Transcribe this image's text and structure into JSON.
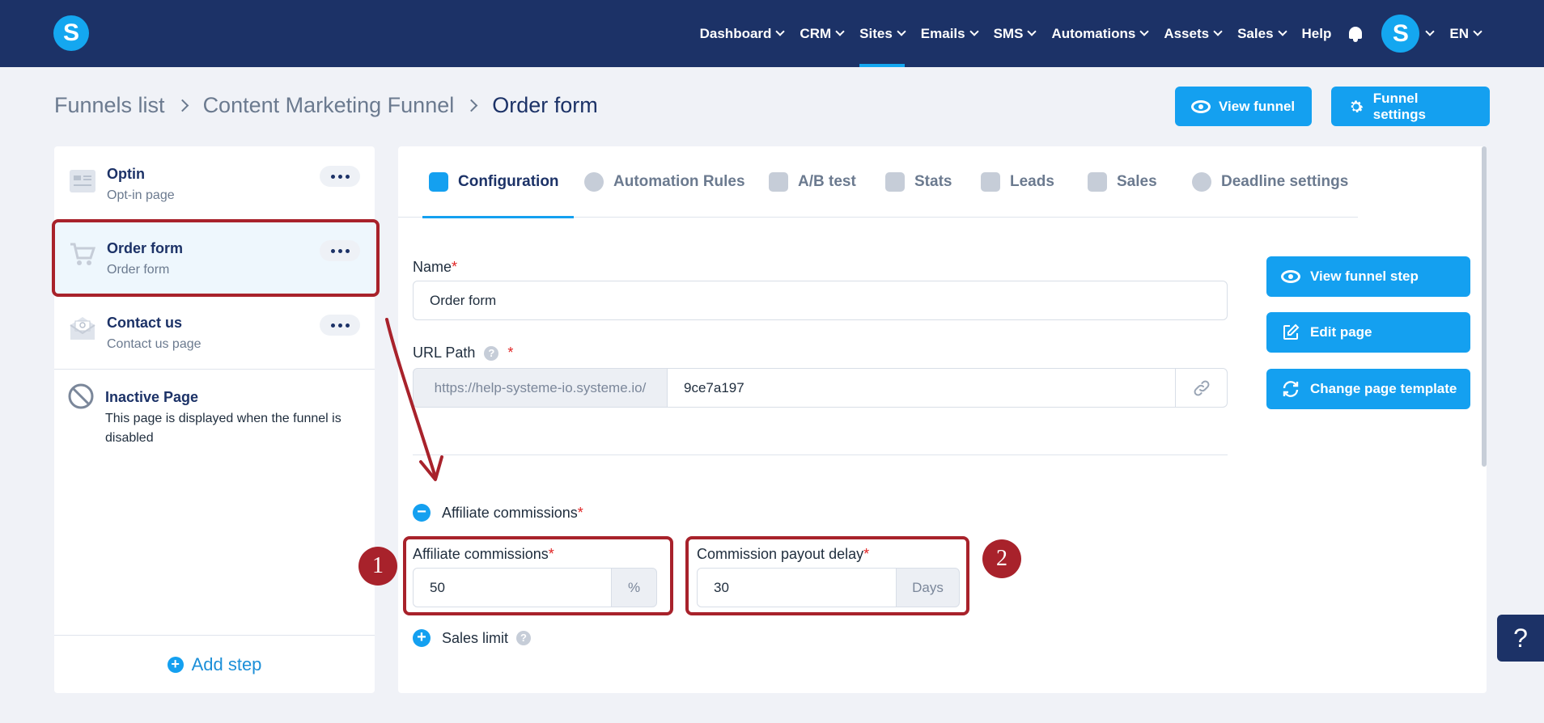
{
  "app": {
    "logo_letter": "S"
  },
  "nav": {
    "items": [
      {
        "label": "Dashboard",
        "chevron": true,
        "active": false
      },
      {
        "label": "CRM",
        "chevron": true,
        "active": false
      },
      {
        "label": "Sites",
        "chevron": true,
        "active": true
      },
      {
        "label": "Emails",
        "chevron": true,
        "active": false
      },
      {
        "label": "SMS",
        "chevron": true,
        "active": false
      },
      {
        "label": "Automations",
        "chevron": true,
        "active": false
      },
      {
        "label": "Assets",
        "chevron": true,
        "active": false
      },
      {
        "label": "Sales",
        "chevron": true,
        "active": false
      },
      {
        "label": "Help",
        "chevron": false,
        "active": false
      }
    ],
    "avatar_letter": "S",
    "language": "EN"
  },
  "breadcrumb": {
    "root": "Funnels list",
    "funnel": "Content Marketing Funnel",
    "current": "Order form"
  },
  "header_buttons": {
    "view_funnel": "View funnel",
    "funnel_settings": "Funnel settings"
  },
  "sidebar": {
    "steps": [
      {
        "title": "Optin",
        "subtitle": "Opt-in page"
      },
      {
        "title": "Order form",
        "subtitle": "Order form"
      },
      {
        "title": "Contact us",
        "subtitle": "Contact us page"
      }
    ],
    "inactive": {
      "title": "Inactive Page",
      "desc_line1": "This page is displayed when the funnel is",
      "desc_line2": "disabled"
    },
    "add_step": "Add step"
  },
  "tabs": [
    "Configuration",
    "Automation Rules",
    "A/B test",
    "Stats",
    "Leads",
    "Sales",
    "Deadline settings"
  ],
  "form": {
    "name_label": "Name",
    "name_value": "Order form",
    "url_label": "URL Path",
    "url_prefix": "https://help-systeme-io.systeme.io/",
    "url_value": "9ce7a197",
    "affiliate_section": "Affiliate commissions",
    "commission_label": "Affiliate commissions",
    "commission_value": "50",
    "commission_unit": "%",
    "payout_label": "Commission payout delay",
    "payout_value": "30",
    "payout_unit": "Days",
    "sales_limit": "Sales limit",
    "required_mark": "*",
    "help_mark": "?"
  },
  "side_buttons": {
    "view_step": "View funnel step",
    "edit_page": "Edit page",
    "change_template": "Change page template"
  },
  "annotations": {
    "badge1": "1",
    "badge2": "2"
  },
  "colors": {
    "navbar": "#1c3267",
    "accent": "#14a0f0",
    "highlight": "#a8222b"
  },
  "help_float": "?"
}
